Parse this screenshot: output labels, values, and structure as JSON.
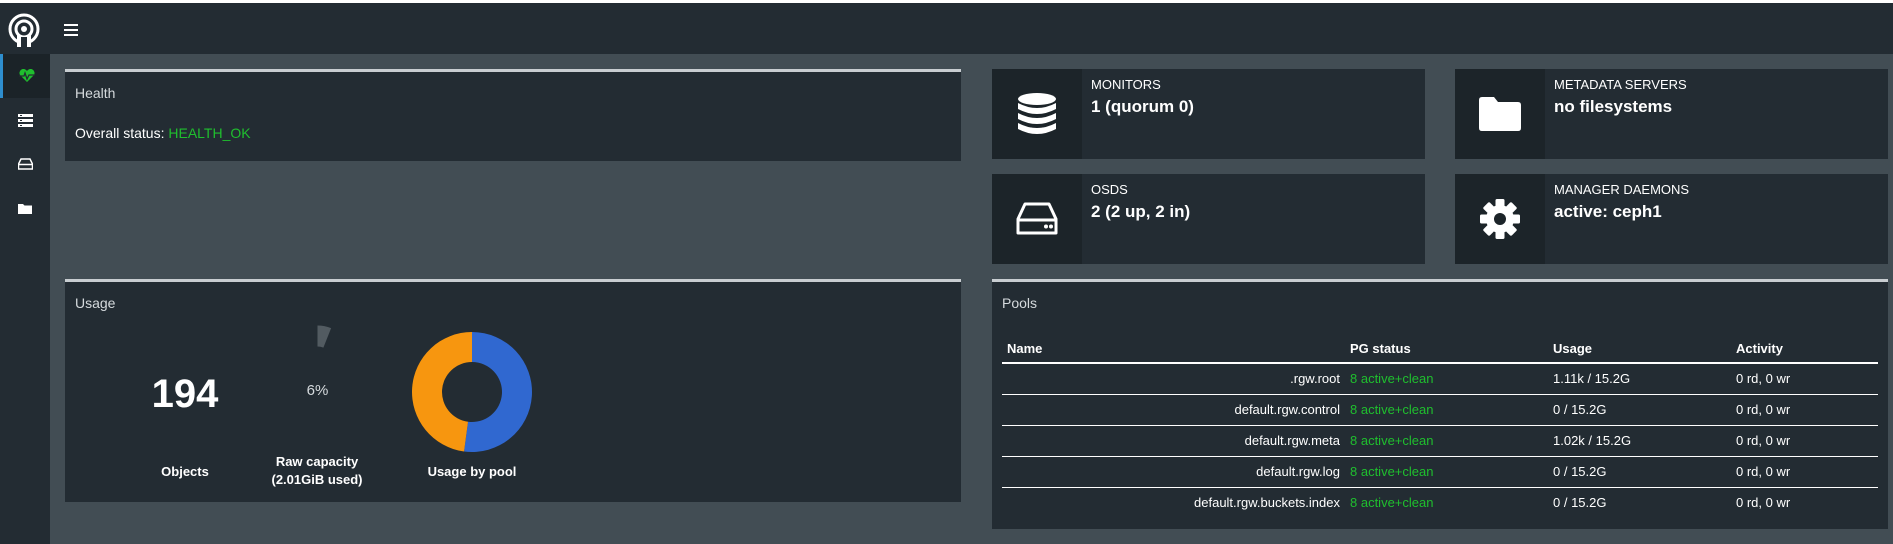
{
  "sidebar": {
    "items": [
      "health-icon",
      "servers-icon",
      "drive-icon",
      "folder-icon"
    ]
  },
  "health": {
    "title": "Health",
    "status_label": "Overall status:",
    "status_value": "HEALTH_OK"
  },
  "stats": {
    "monitors": {
      "label": "MONITORS",
      "value": "1 (quorum 0)",
      "icon": "database-icon"
    },
    "metadata": {
      "label": "METADATA SERVERS",
      "value": "no filesystems",
      "icon": "folder-icon"
    },
    "osds": {
      "label": "OSDS",
      "value": "2 (2 up, 2 in)",
      "icon": "hard-drive-icon"
    },
    "managers": {
      "label": "MANAGER DAEMONS",
      "value": "active: ceph1",
      "icon": "gear-icon"
    }
  },
  "usage": {
    "title": "Usage",
    "objects_value": "194",
    "objects_label": "Objects",
    "raw_capacity_pct_text": "6%",
    "raw_capacity_fraction": 0.06,
    "raw_capacity_label_1": "Raw capacity",
    "raw_capacity_label_2": "(2.01GiB used)",
    "pool_chart_label": "Usage by pool"
  },
  "chart_data": {
    "type": "pie",
    "donut": true,
    "values": [
      1.11,
      1.02
    ],
    "colors": [
      "#3068d0",
      "#f7960f"
    ]
  },
  "pools": {
    "title": "Pools",
    "headers": [
      "Name",
      "PG status",
      "Usage",
      "Activity"
    ],
    "rows": [
      {
        "name": ".rgw.root",
        "pg": "8 active+clean",
        "usage": "1.11k / 15.2G",
        "activity": "0 rd, 0 wr"
      },
      {
        "name": "default.rgw.control",
        "pg": "8 active+clean",
        "usage": "0 / 15.2G",
        "activity": "0 rd, 0 wr"
      },
      {
        "name": "default.rgw.meta",
        "pg": "8 active+clean",
        "usage": "1.02k / 15.2G",
        "activity": "0 rd, 0 wr"
      },
      {
        "name": "default.rgw.log",
        "pg": "8 active+clean",
        "usage": "0 / 15.2G",
        "activity": "0 rd, 0 wr"
      },
      {
        "name": "default.rgw.buckets.index",
        "pg": "8 active+clean",
        "usage": "0 / 15.2G",
        "activity": "0 rd, 0 wr"
      }
    ]
  },
  "colors": {
    "ok": "#1fbf2e",
    "accent": "#2e8ece",
    "pool_a": "#3068d0",
    "pool_b": "#f7960f"
  }
}
